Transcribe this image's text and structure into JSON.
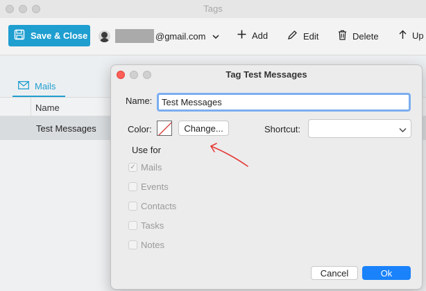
{
  "window": {
    "title": "Tags"
  },
  "toolbar": {
    "save_close_label": "Save & Close",
    "account_email_suffix": "@gmail.com",
    "add_label": "Add",
    "edit_label": "Edit",
    "delete_label": "Delete",
    "up_label": "Up"
  },
  "tabs": {
    "mails_label": "Mails"
  },
  "list": {
    "column_name": "Name",
    "rows": [
      "Test Messages"
    ]
  },
  "dialog": {
    "title": "Tag Test Messages",
    "name_label": "Name:",
    "name_value": "Test Messages",
    "color_label": "Color:",
    "change_label": "Change...",
    "shortcut_label": "Shortcut:",
    "shortcut_value": "",
    "use_for_label": "Use for",
    "use_for": [
      {
        "label": "Mails",
        "checked": true
      },
      {
        "label": "Events",
        "checked": false
      },
      {
        "label": "Contacts",
        "checked": false
      },
      {
        "label": "Tasks",
        "checked": false
      },
      {
        "label": "Notes",
        "checked": false
      }
    ],
    "cancel_label": "Cancel",
    "ok_label": "Ok"
  },
  "colors": {
    "accent": "#1f9ed0",
    "ok_button": "#1a82fb",
    "annotation": "#e53935"
  },
  "icons": [
    "save-icon",
    "avatar-icon",
    "chevron-down-icon",
    "plus-icon",
    "pencil-icon",
    "trash-icon",
    "up-arrow-icon",
    "envelope-icon"
  ]
}
